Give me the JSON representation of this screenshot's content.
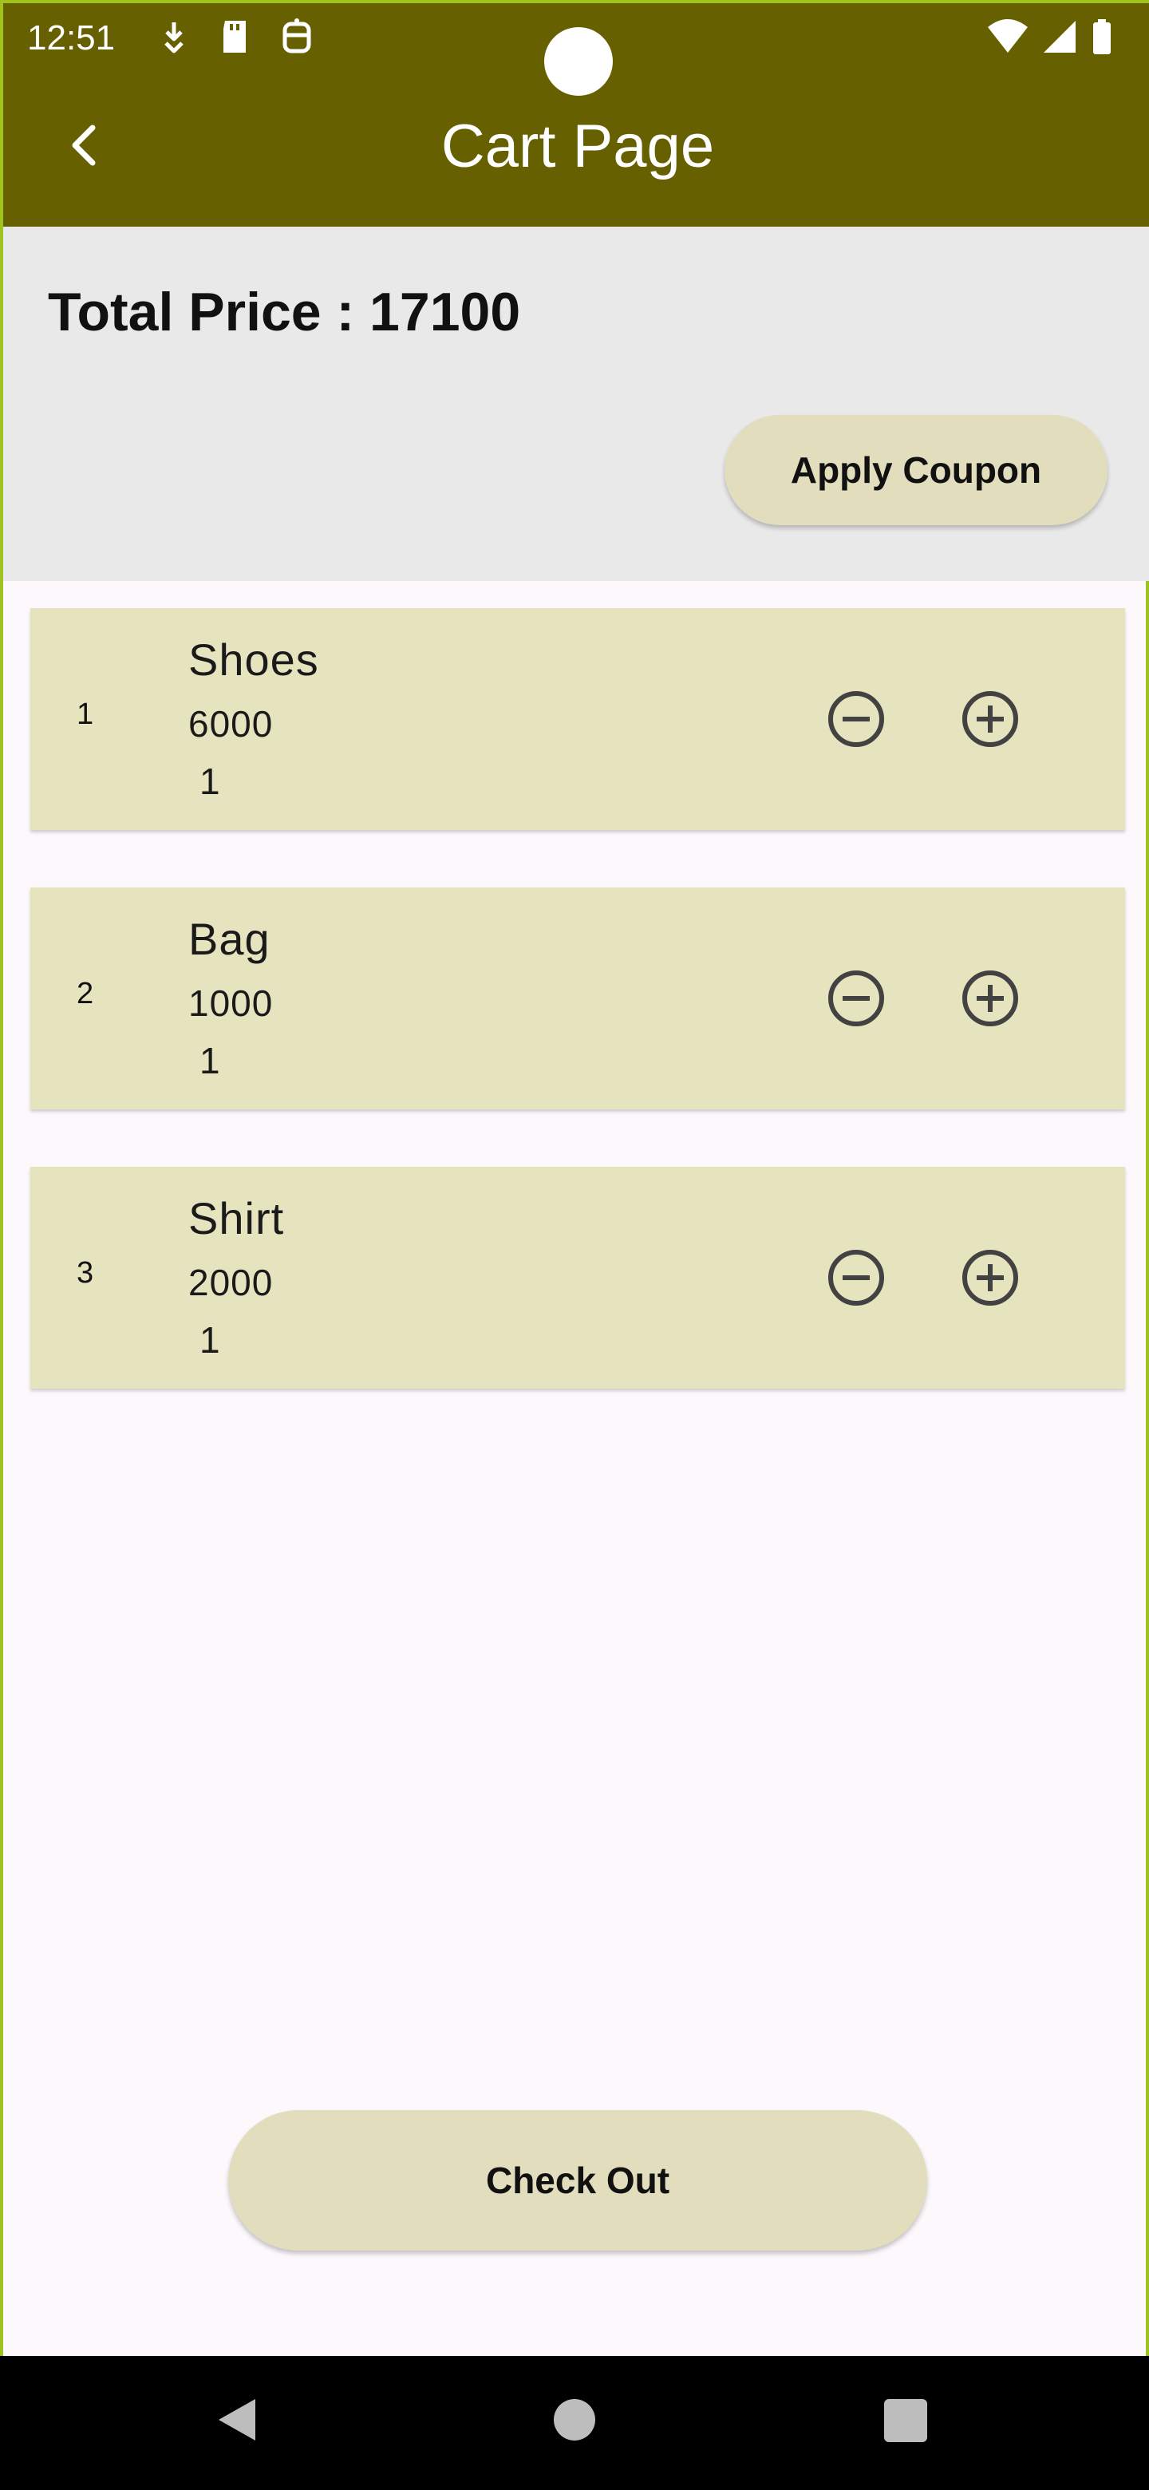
{
  "status_bar": {
    "time": "12:51",
    "left_icons": [
      "download-arrow-icon",
      "sd-card-icon",
      "accessibility-icon"
    ],
    "right_icons": [
      "wifi-icon",
      "signal-icon",
      "battery-icon"
    ]
  },
  "header": {
    "title": "Cart Page",
    "back_icon": "chevron-left-icon",
    "background": "#666000"
  },
  "summary": {
    "total_price": "Total Price : 17100",
    "apply_coupon_label": "Apply Coupon"
  },
  "cart": {
    "items": [
      {
        "index": "1",
        "name": "Shoes",
        "price": "6000",
        "quantity": "1"
      },
      {
        "index": "2",
        "name": "Bag",
        "price": "1000",
        "quantity": "1"
      },
      {
        "index": "3",
        "name": "Shirt",
        "price": "2000",
        "quantity": "1"
      }
    ]
  },
  "footer": {
    "checkout_label": "Check Out"
  },
  "colors": {
    "accent": "#666000",
    "card": "#e6e3bf",
    "button": "#e1ddbd"
  }
}
